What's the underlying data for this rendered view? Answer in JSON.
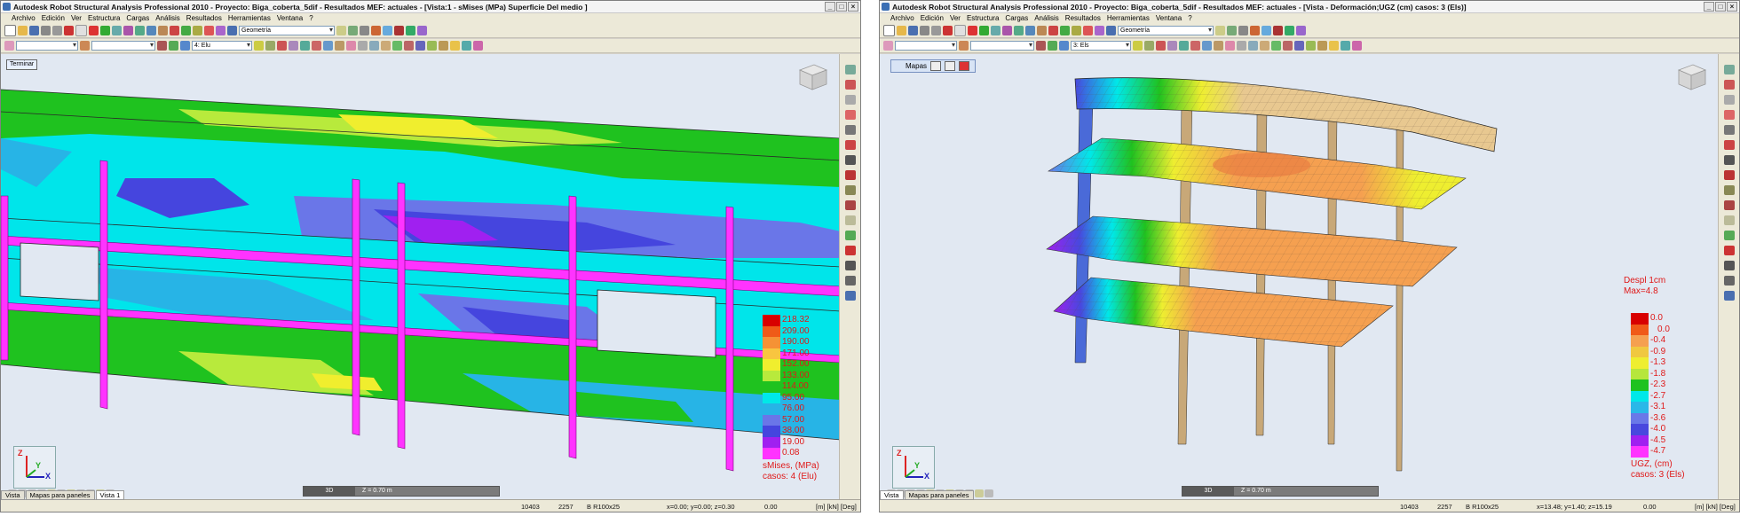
{
  "colors": {
    "legend_text": "#e01818",
    "viewport_bg": "#e1e8f2"
  },
  "left": {
    "title": "Autodesk Robot Structural Analysis Professional 2010 - Proyecto: Biga_coberta_5dif - Resultados MEF: actuales - [Vista:1 - sMises (MPa) Superficie Del medio ]",
    "window_buttons": [
      "_",
      "□",
      "×"
    ],
    "menu": [
      "Archivo",
      "Edición",
      "Ver",
      "Estructura",
      "Cargas",
      "Análisis",
      "Resultados",
      "Herramientas",
      "Ventana",
      "?"
    ],
    "combo_geometry": "Geometría",
    "combo_case": "4: Elu",
    "overlay_label": "Terminar",
    "view_mode": "3D",
    "z_value": "Z = 0.70 m",
    "axis_labels": {
      "x": "X",
      "y": "Y",
      "z": "Z"
    },
    "legend": {
      "values": [
        "218.32",
        "209.00",
        "190.00",
        "171.00",
        "152.00",
        "133.00",
        "114.00",
        "95.00",
        "76.00",
        "57.00",
        "38.00",
        "19.00",
        "0.08"
      ],
      "colors": [
        "#d80000",
        "#ef5a18",
        "#f59235",
        "#f8c540",
        "#f0ee2e",
        "#b8ea3c",
        "#1fc21f",
        "#00e8e8",
        "#27b4e6",
        "#6a76e8",
        "#4545de",
        "#a020f0",
        "#ff33ff"
      ],
      "caption_1": "sMises, (MPa)",
      "caption_2": "casos: 4 (Elu)"
    },
    "tabs": [
      "Vista",
      "Mapas para paneles",
      "Vista 1"
    ],
    "status": {
      "nodes": "10403",
      "elements": "2257",
      "section": "B R100x25",
      "coords": "x=0.00; y=0.00; z=0.30",
      "temp": "0.00",
      "units": "[m] [kN] [Deg]"
    }
  },
  "right": {
    "title": "Autodesk Robot Structural Analysis Professional 2010 - Proyecto: Biga_coberta_5dif - Resultados MEF: actuales - [Vista - Deformación;UGZ (cm) casos: 3 (Els)]",
    "window_buttons": [
      "_",
      "□",
      "×"
    ],
    "menu": [
      "Archivo",
      "Edición",
      "Ver",
      "Estructura",
      "Cargas",
      "Análisis",
      "Resultados",
      "Herramientas",
      "Ventana",
      "?"
    ],
    "combo_geometry": "Geometría",
    "combo_case": "3: Els",
    "panel_title": "Mapas",
    "view_mode": "3D",
    "z_value": "Z = 0.70 m",
    "axis_labels": {
      "x": "X",
      "y": "Y",
      "z": "Z"
    },
    "displacement": {
      "label": "Despl  1cm",
      "max": "Max=4.8"
    },
    "legend": {
      "values": [
        "0.0",
        "0.0",
        "-0.4",
        "-0.9",
        "-1.3",
        "-1.8",
        "-2.3",
        "-2.7",
        "-3.1",
        "-3.6",
        "-4.0",
        "-4.5",
        "-4.7"
      ],
      "colors": [
        "#d80000",
        "#f05a18",
        "#f5a050",
        "#f0c840",
        "#eeee30",
        "#b6e63c",
        "#1fc21f",
        "#00e8e8",
        "#2ab8e8",
        "#6a78e8",
        "#4848de",
        "#a020f0",
        "#ff33ff"
      ],
      "caption_1": "UGZ, (cm)",
      "caption_2": "casos: 3 (Els)"
    },
    "tabs": [
      "Vista",
      "Mapas para paneles"
    ],
    "status": {
      "nodes": "10403",
      "elements": "2257",
      "section": "B R100x25",
      "coords": "x=13.48; y=1.40; z=15.19",
      "temp": "0.00",
      "units": "[m] [kN] [Deg]"
    }
  }
}
